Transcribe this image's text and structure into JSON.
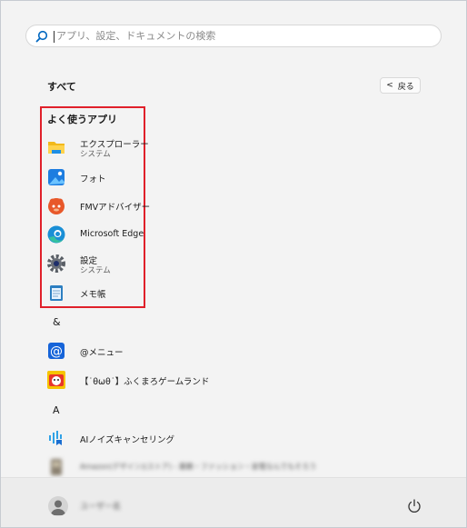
{
  "search": {
    "placeholder": "アプリ、設定、ドキュメントの検索"
  },
  "header": {
    "title": "すべて",
    "back_label": "戻る"
  },
  "frequent": {
    "heading": "よく使うアプリ",
    "items": [
      {
        "name": "エクスプローラー",
        "sub": "システム",
        "icon": "folder-icon"
      },
      {
        "name": "フォト",
        "sub": "",
        "icon": "photos-icon"
      },
      {
        "name": "FMVアドバイザー",
        "sub": "",
        "icon": "fmv-advisor-icon"
      },
      {
        "name": "Microsoft Edge",
        "sub": "",
        "icon": "edge-icon"
      },
      {
        "name": "設定",
        "sub": "システム",
        "icon": "gear-icon"
      },
      {
        "name": "メモ帳",
        "sub": "",
        "icon": "notepad-icon"
      }
    ]
  },
  "groups": [
    {
      "letter": "&",
      "items": [
        {
          "name": "@メニュー",
          "icon": "at-menu-icon"
        },
        {
          "name": "【˙θωθ˙】ふくまろゲームランド",
          "icon": "fukumaro-icon"
        }
      ]
    },
    {
      "letter": "A",
      "items": [
        {
          "name": "AIノイズキャンセリング",
          "icon": "ai-noise-icon"
        },
        {
          "name": "Amazon(デザイン)(ストア) - 書籍・ファッション・家電なんでもそろう",
          "icon": "amazon-icon"
        }
      ]
    }
  ],
  "footer": {
    "username": "ユーザー名",
    "power_icon": "power-icon"
  },
  "colors": {
    "highlight": "#e0202a",
    "accent": "#0067c0"
  }
}
